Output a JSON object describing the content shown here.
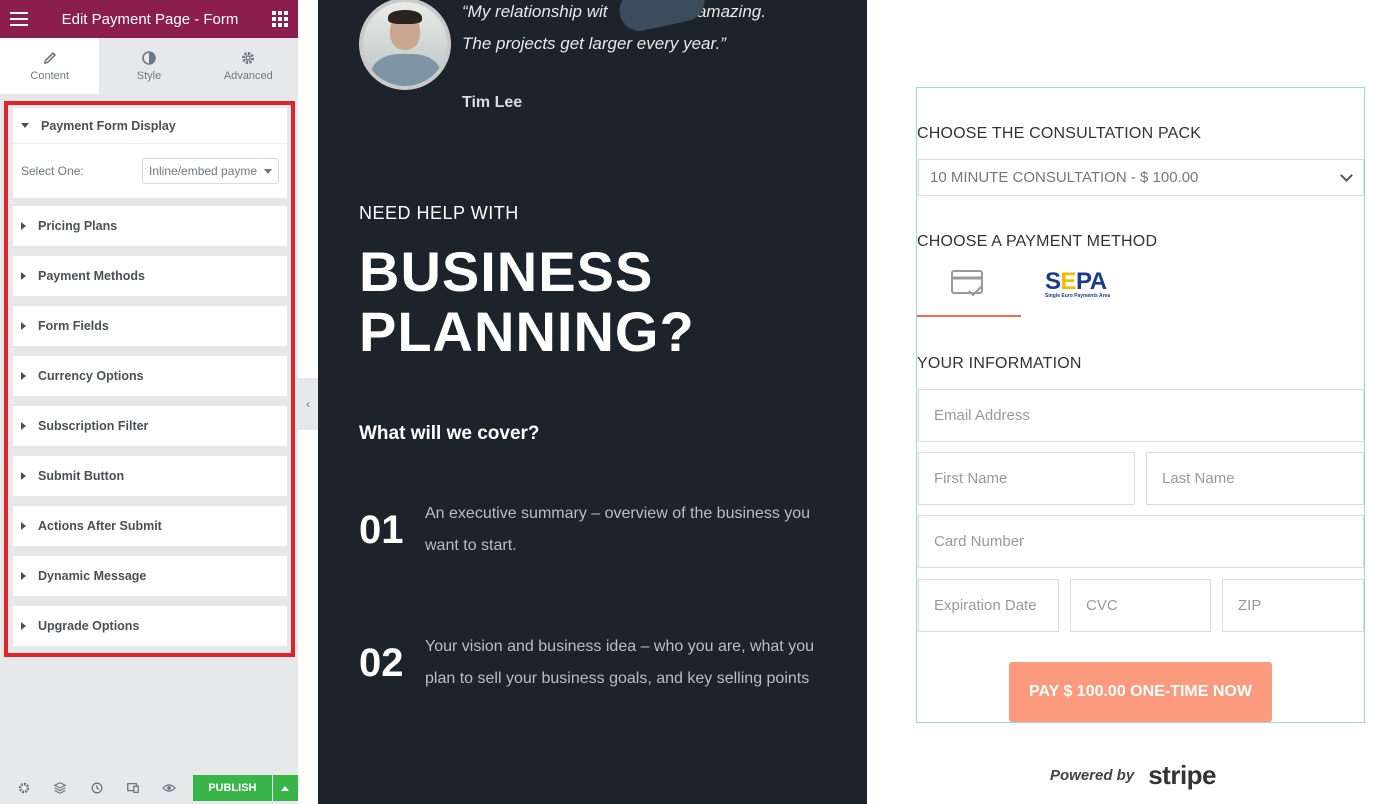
{
  "editor": {
    "title": "Edit Payment Page - Form",
    "tabs": [
      {
        "label": "Content",
        "icon": "pencil-icon"
      },
      {
        "label": "Style",
        "icon": "contrast-icon"
      },
      {
        "label": "Advanced",
        "icon": "gear-icon"
      }
    ],
    "open_section": {
      "label": "Payment Form Display",
      "select_label": "Select One:",
      "select_value": "Inline/embed payme"
    },
    "sections": [
      "Pricing Plans",
      "Payment Methods",
      "Form Fields",
      "Currency Options",
      "Subscription Filter",
      "Submit Button",
      "Actions After Submit",
      "Dynamic Message",
      "Upgrade Options"
    ],
    "footer": {
      "publish_label": "PUBLISH"
    },
    "header_color": "#8b1e4c",
    "publish_color": "#39b54a"
  },
  "page": {
    "quote_line1": "“My relationship wit",
    "quote_line1b": "amazing.",
    "quote_line2": "The projects get larger every year.”",
    "author": "Tim Lee",
    "need": "NEED HELP WITH",
    "headline_1": "BUSINESS",
    "headline_2": "PLANNING?",
    "cover": "What will we cover?",
    "items": [
      {
        "num": "01",
        "text": "An executive summary – overview of the business you want to start."
      },
      {
        "num": "02",
        "text": "Your vision and business idea – who you are, what you plan to sell your business goals, and key selling points"
      }
    ],
    "dark_bg": "#1c232b"
  },
  "form": {
    "pack_title": "CHOOSE THE CONSULTATION PACK",
    "pack_value": "10 MINUTE CONSULTATION - $ 100.00",
    "method_title": "CHOOSE A PAYMENT METHOD",
    "sepa_logo": "SEPA",
    "sepa_sub": "Single Euro Payments Area",
    "info_title": "YOUR INFORMATION",
    "email_placeholder": "Email Address",
    "first_placeholder": "First Name",
    "last_placeholder": "Last Name",
    "card_placeholder": "Card Number",
    "exp_placeholder": "Expiration Date",
    "cvc_placeholder": "CVC",
    "zip_placeholder": "ZIP",
    "pay_label": "PAY $ 100.00 ONE-TIME NOW",
    "powered_by": "Powered by",
    "stripe": "stripe",
    "accent_color": "#f26b4a",
    "button_color": "#fb9a7c"
  }
}
